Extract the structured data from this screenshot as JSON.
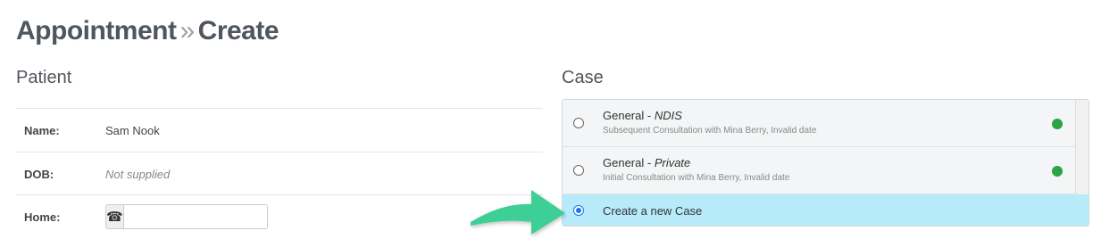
{
  "page": {
    "title_main": "Appointment",
    "title_sep": "»",
    "title_sub": "Create"
  },
  "patient": {
    "heading": "Patient",
    "name_label": "Name:",
    "name_value": "Sam Nook",
    "dob_label": "DOB:",
    "dob_value": "Not supplied",
    "home_label": "Home:",
    "home_icon": "phone-icon",
    "home_value": ""
  },
  "case": {
    "heading": "Case",
    "items": [
      {
        "title": "General - ",
        "type": "NDIS",
        "subtitle": "Subsequent Consultation with Mina Berry, Invalid date",
        "selected": false,
        "status_color": "#2aa445"
      },
      {
        "title": "General - ",
        "type": "Private",
        "subtitle": "Initial Consultation with Mina Berry, Invalid date",
        "selected": false,
        "status_color": "#2aa445"
      },
      {
        "title": "Create a new Case",
        "selected": true
      }
    ]
  },
  "colors": {
    "selected_row": "#b7ebfa",
    "status_green": "#2aa445",
    "arrow_green": "#3ecf95",
    "radio_blue": "#1a73e8"
  }
}
